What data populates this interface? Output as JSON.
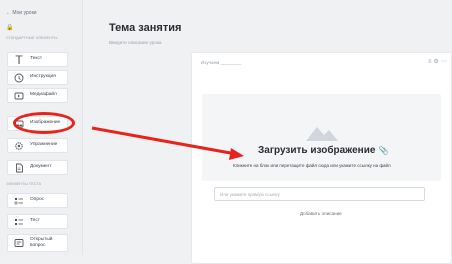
{
  "sidebar": {
    "back_label": "← Мои уроки",
    "section_standard": "Стандартные элементы",
    "section_test": "Элементы теста",
    "items_standard": [
      {
        "label": "Текст",
        "icon": "text-icon"
      },
      {
        "label": "Инструкция",
        "icon": "clock-icon"
      },
      {
        "label": "Медиафайл",
        "icon": "media-icon"
      },
      {
        "label": "Изображение",
        "icon": "image-icon"
      },
      {
        "label": "Упражнение",
        "icon": "settings-icon"
      },
      {
        "label": "Документ",
        "icon": "document-icon"
      }
    ],
    "items_test": [
      {
        "label": "Опрос",
        "icon": "poll-icon"
      },
      {
        "label": "Тест",
        "icon": "test-icon"
      },
      {
        "label": "Открытый вопрос",
        "icon": "open-question-icon"
      }
    ]
  },
  "page": {
    "title": "Тема занятия",
    "subtitle": "Введите описание урока"
  },
  "card": {
    "header": "Изучаем ________",
    "upload_title": "Загрузить изображение",
    "upload_desc": "Кликните на блок или перетащите файл сюда или укажите ссылку на файл",
    "url_placeholder": "Или укажите прямую ссылку",
    "add_description": "Добавить описание"
  },
  "colors": {
    "annotation": "#e8231c",
    "background": "#f0f1f3"
  }
}
